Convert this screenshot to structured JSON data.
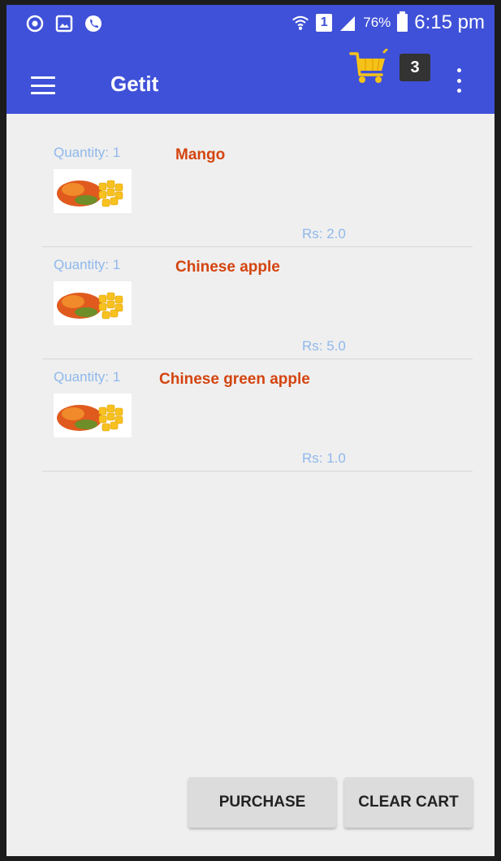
{
  "status_bar": {
    "battery": "76%",
    "time": "6:15 pm",
    "sim": "1"
  },
  "app_bar": {
    "title": "Getit",
    "cart_count": "3"
  },
  "cart": {
    "items": [
      {
        "quantity": "Quantity: 1",
        "name": "Mango",
        "price": "Rs: 2.0"
      },
      {
        "quantity": "Quantity: 1",
        "name": "Chinese apple",
        "price": "Rs: 5.0"
      },
      {
        "quantity": "Quantity: 1",
        "name": "Chinese green apple",
        "price": "Rs: 1.0"
      }
    ]
  },
  "actions": {
    "purchase_label": "PURCHASE",
    "clear_label": "CLEAR CART"
  },
  "colors": {
    "primary": "#3f51d8",
    "product_name": "#d4440f",
    "secondary_text": "#8fb8ec"
  }
}
